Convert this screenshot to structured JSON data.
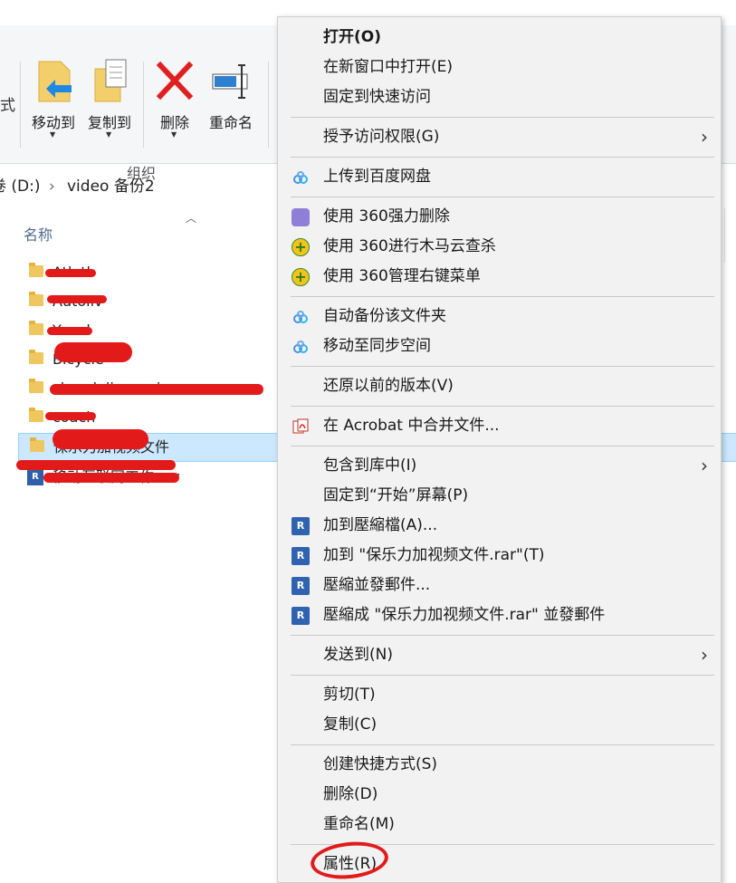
{
  "ribbon": {
    "left_partial": "式",
    "buttons": [
      {
        "label": "移动到",
        "icon": "move-to-icon"
      },
      {
        "label": "复制到",
        "icon": "copy-to-icon"
      },
      {
        "label": "删除",
        "icon": "delete-icon"
      },
      {
        "label": "重命名",
        "icon": "rename-icon"
      }
    ],
    "group_label": "组织"
  },
  "breadcrumb": {
    "drive": "卷 (D:)",
    "separator": "›",
    "folder": "video 备份2"
  },
  "file_list": {
    "column_name": "名称",
    "items": [
      {
        "name": "Atlatl",
        "type": "folder"
      },
      {
        "name": "Autoliv",
        "type": "folder"
      },
      {
        "name": "Yanal",
        "type": "folder"
      },
      {
        "name": "Bicycle",
        "type": "folder"
      },
      {
        "name": "chandelier review",
        "type": "folder"
      },
      {
        "name": "coach",
        "type": "folder"
      },
      {
        "name": "保乐力加视频文件",
        "type": "folder",
        "selected": true
      },
      {
        "name": "移动互联网工作.rar",
        "type": "rar"
      }
    ]
  },
  "context_menu": {
    "items": [
      {
        "label": "打开(O)",
        "bold": true
      },
      {
        "label": "在新窗口中打开(E)"
      },
      {
        "label": "固定到快速访问"
      },
      {
        "label": "授予访问权限(G)",
        "submenu": true
      },
      {
        "label": "上传到百度网盘",
        "icon": "baidu-cloud-icon"
      },
      {
        "label": "使用 360强力删除",
        "icon": "360-shredder-icon"
      },
      {
        "label": "使用 360进行木马云查杀",
        "icon": "360-scan-icon"
      },
      {
        "label": "使用 360管理右键菜单",
        "icon": "360-menu-icon"
      },
      {
        "label": "自动备份该文件夹",
        "icon": "baidu-cloud-icon"
      },
      {
        "label": "移动至同步空间",
        "icon": "baidu-cloud-icon"
      },
      {
        "label": "还原以前的版本(V)"
      },
      {
        "label": "在 Acrobat 中合并文件...",
        "icon": "acrobat-icon"
      },
      {
        "label": "包含到库中(I)",
        "submenu": true
      },
      {
        "label": "固定到“开始”屏幕(P)"
      },
      {
        "label": "加到壓縮檔(A)...",
        "icon": "winrar-icon"
      },
      {
        "label": "加到 \"保乐力加视频文件.rar\"(T)",
        "icon": "winrar-icon"
      },
      {
        "label": "壓縮並發郵件...",
        "icon": "winrar-icon"
      },
      {
        "label": "壓縮成 \"保乐力加视频文件.rar\" 並發郵件",
        "icon": "winrar-icon"
      },
      {
        "label": "发送到(N)",
        "submenu": true
      },
      {
        "label": "剪切(T)"
      },
      {
        "label": "复制(C)"
      },
      {
        "label": "创建快捷方式(S)"
      },
      {
        "label": "删除(D)"
      },
      {
        "label": "重命名(M)"
      },
      {
        "label": "属性(R)"
      }
    ],
    "submenu_arrow": "›"
  },
  "colors": {
    "menu_bg": "#f2f2f2",
    "selection_bg": "#cce8ff",
    "annotation_red": "#e31a1a"
  }
}
